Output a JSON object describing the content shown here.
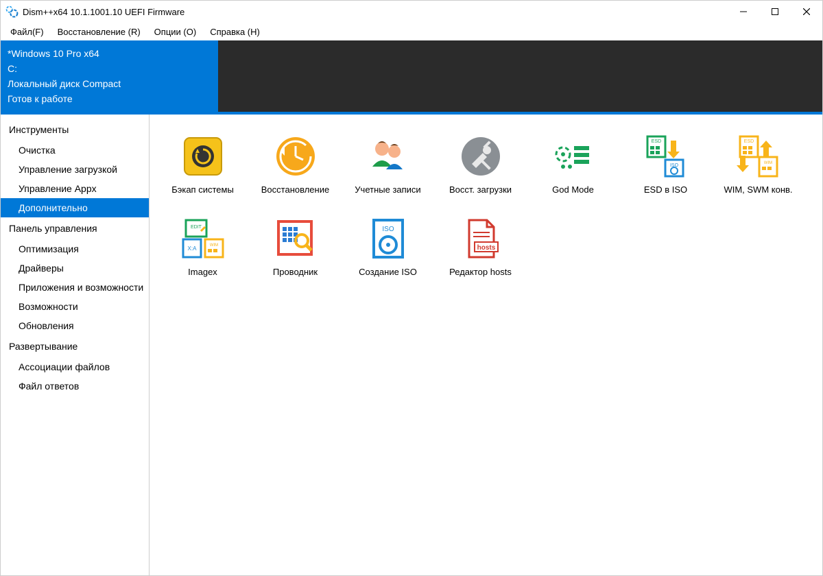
{
  "title": "Dism++x64 10.1.1001.10 UEFI Firmware",
  "menu": {
    "file": "Файл(F)",
    "recovery": "Восстановление (R)",
    "options": "Опции (O)",
    "help": "Справка (H)"
  },
  "sysinfo": {
    "line1": "*Windows 10 Pro x64",
    "line2": "C:",
    "line3": "Локальный диск Compact",
    "line4": "Готов к работе"
  },
  "sidebar": {
    "sec1": "Инструменты",
    "sec1_items": [
      "Очистка",
      "Управление загрузкой",
      "Управление Appx",
      "Дополнительно"
    ],
    "sec2": "Панель управления",
    "sec2_items": [
      "Оптимизация",
      "Драйверы",
      "Приложения и возможности",
      "Возможности",
      "Обновления"
    ],
    "sec3": "Развертывание",
    "sec3_items": [
      "Ассоциации файлов",
      "Файл ответов"
    ]
  },
  "selected_side": "Дополнительно",
  "tools": {
    "backup": "Бэкап системы",
    "restore": "Восстановление",
    "accounts": "Учетные записи",
    "bootrepair": "Восст. загрузки",
    "godmode": "God Mode",
    "esdiso": "ESD в ISO",
    "wimconv": "WIM, SWM конв.",
    "imagex": "Imagex",
    "explorer": "Проводник",
    "isomake": "Создание ISO",
    "hosts": "Редактор hosts"
  }
}
